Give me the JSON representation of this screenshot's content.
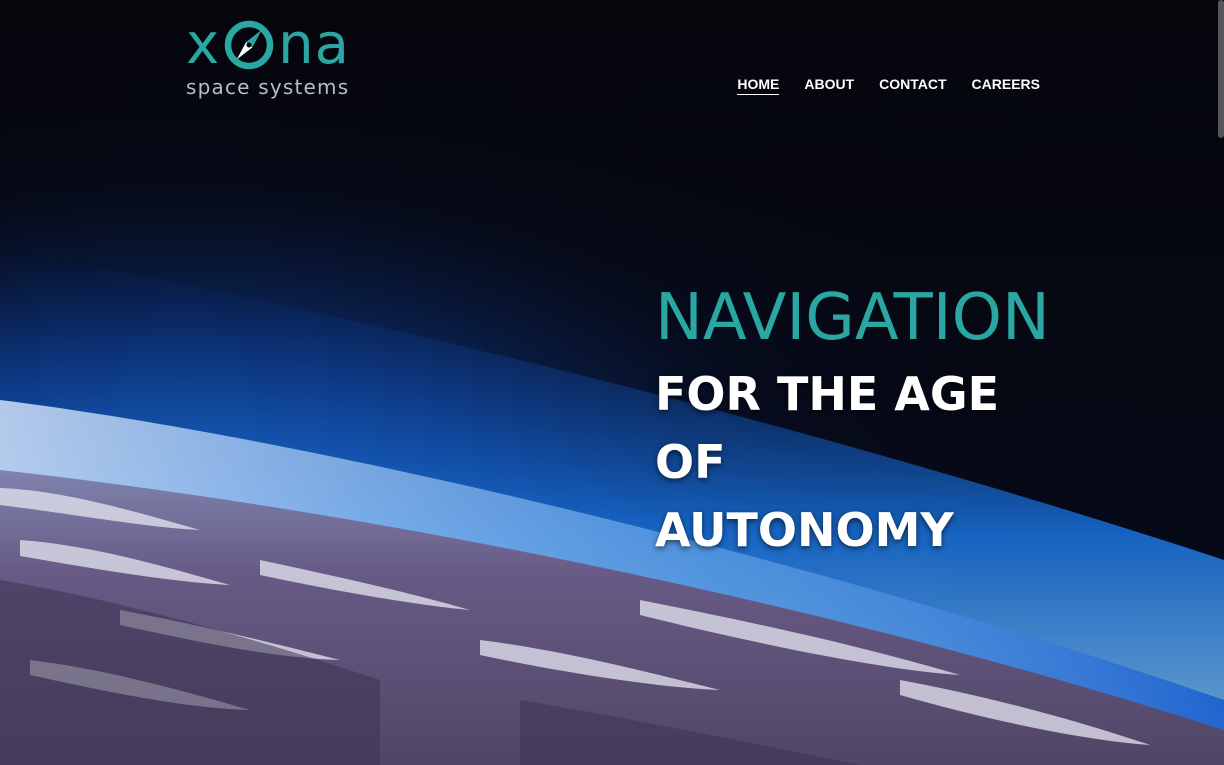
{
  "brand": {
    "logo_x": "x",
    "logo_na": "na",
    "tagline": "space systems",
    "colors": {
      "accent": "#2aa7a3",
      "tagline": "#b9bcc3",
      "background": "#05060c"
    }
  },
  "nav": {
    "items": [
      {
        "label": "HOME",
        "active": true
      },
      {
        "label": "ABOUT",
        "active": false
      },
      {
        "label": "CONTACT",
        "active": false
      },
      {
        "label": "CAREERS",
        "active": false
      }
    ]
  },
  "hero": {
    "headline_accent": "NAVIGATION",
    "headline_line2": "FOR THE AGE OF",
    "headline_line3": "AUTONOMY",
    "image": "earth-from-space"
  }
}
